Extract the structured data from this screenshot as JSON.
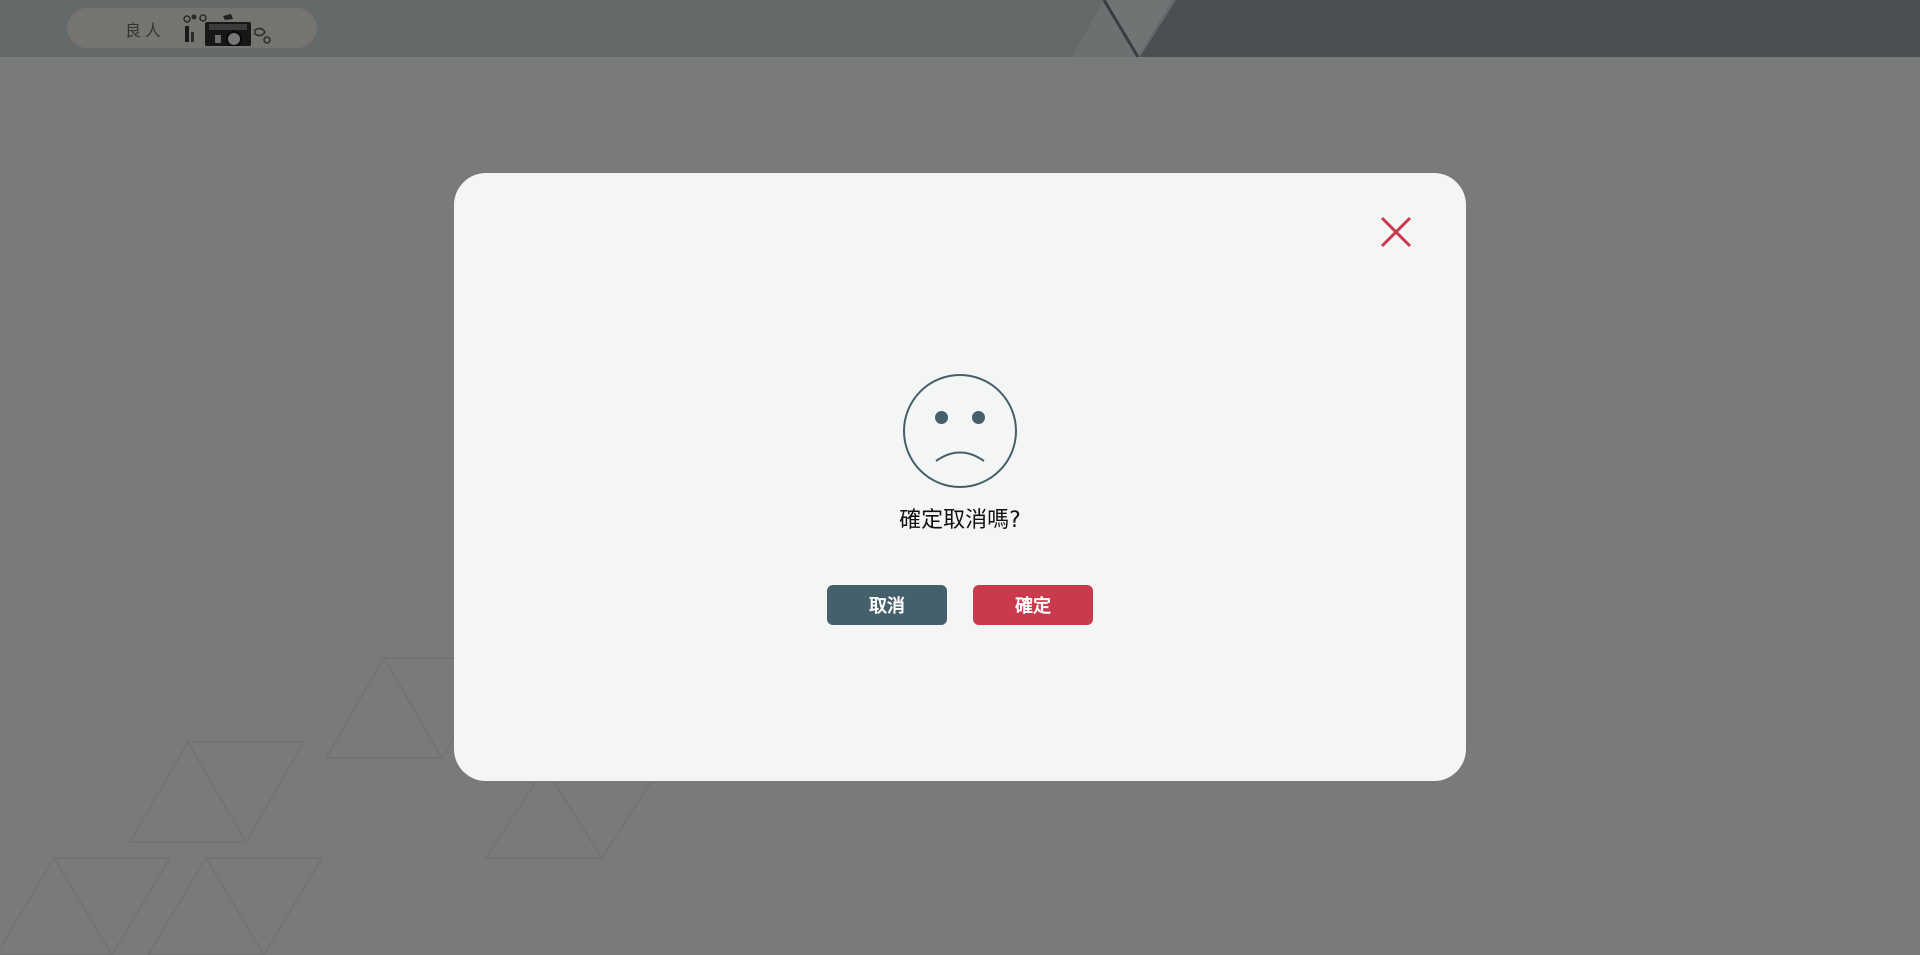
{
  "header": {
    "logo_text": "良人"
  },
  "dialog": {
    "message": "確定取消嗎?",
    "cancel_label": "取消",
    "confirm_label": "確定",
    "close_icon": "close-icon",
    "face_icon": "sad-face-icon"
  },
  "colors": {
    "cancel": "#455f6b",
    "confirm": "#c93a4c",
    "close": "#c93a4c",
    "face": "#455f6b",
    "overlay": "rgba(0,0,0,0.5)"
  }
}
